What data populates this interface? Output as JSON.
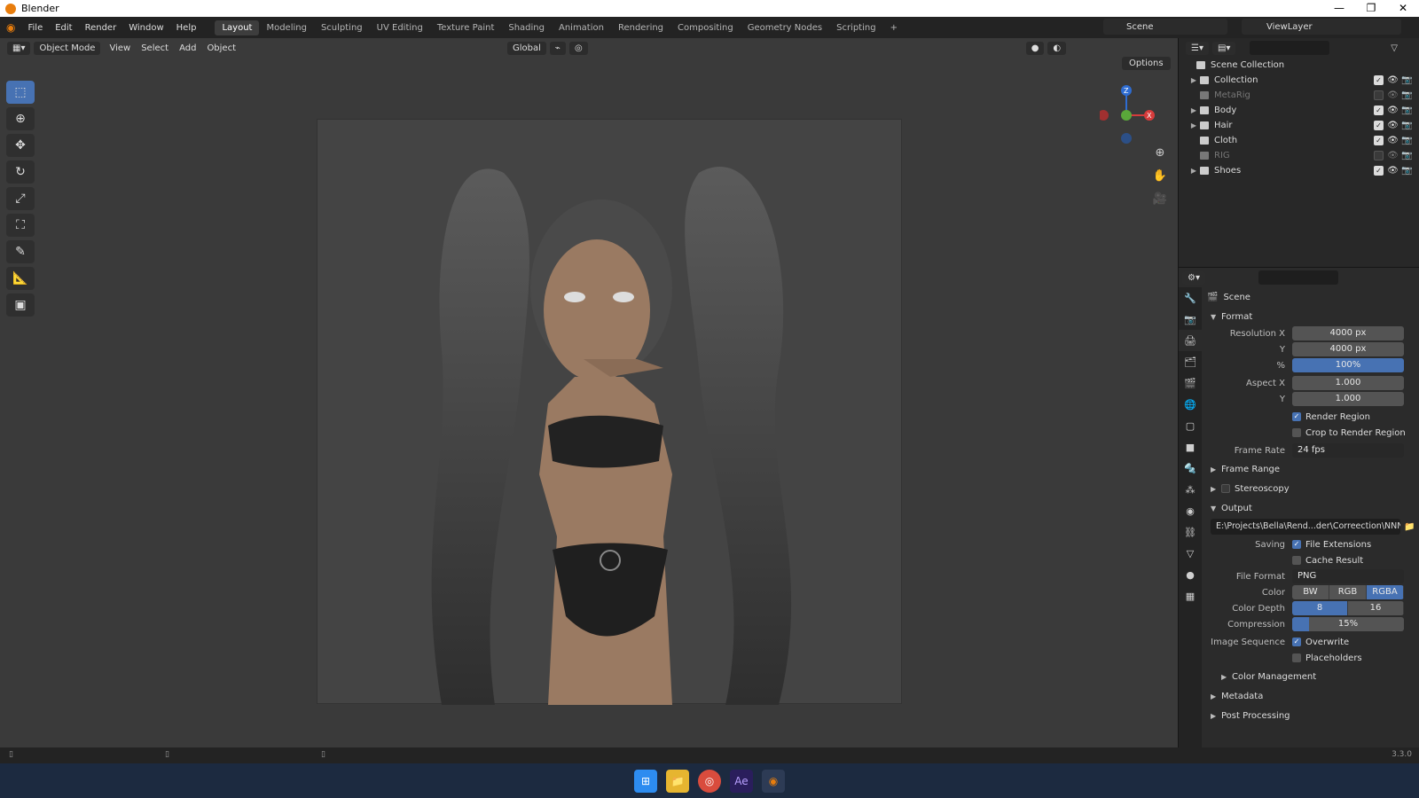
{
  "window": {
    "title": "Blender",
    "controls": [
      "—",
      "❐",
      "✕"
    ]
  },
  "menus": [
    "File",
    "Edit",
    "Render",
    "Window",
    "Help"
  ],
  "workspaces": [
    {
      "label": "Layout",
      "active": true
    },
    {
      "label": "Modeling"
    },
    {
      "label": "Sculpting"
    },
    {
      "label": "UV Editing"
    },
    {
      "label": "Texture Paint"
    },
    {
      "label": "Shading"
    },
    {
      "label": "Animation"
    },
    {
      "label": "Rendering"
    },
    {
      "label": "Compositing"
    },
    {
      "label": "Geometry Nodes"
    },
    {
      "label": "Scripting"
    },
    {
      "label": "+"
    }
  ],
  "scene_name": "Scene",
  "view_layer": "ViewLayer",
  "viewport": {
    "mode": "Object Mode",
    "menus": [
      "View",
      "Select",
      "Add",
      "Object"
    ],
    "transform_orientation": "Global",
    "options_label": "Options"
  },
  "tools": [
    "select-box",
    "cursor",
    "move",
    "rotate",
    "scale",
    "transform",
    "annotate",
    "measure",
    "add-cube"
  ],
  "gizmo": {
    "z": "Z",
    "x": "X"
  },
  "outliner": {
    "root": "Scene Collection",
    "rows": [
      {
        "name": "Collection",
        "expandable": true,
        "visible": true,
        "dim": false
      },
      {
        "name": "MetaRig",
        "expandable": false,
        "visible": false,
        "dim": true
      },
      {
        "name": "Body",
        "expandable": true,
        "visible": true,
        "dim": false
      },
      {
        "name": "Hair",
        "expandable": true,
        "visible": true,
        "dim": false
      },
      {
        "name": "Cloth",
        "expandable": false,
        "visible": true,
        "dim": false
      },
      {
        "name": "RIG",
        "expandable": false,
        "visible": false,
        "dim": true
      },
      {
        "name": "Shoes",
        "expandable": true,
        "visible": true,
        "dim": false
      }
    ]
  },
  "properties": {
    "context": "Scene",
    "format": {
      "header": "Format",
      "resolution_x_label": "Resolution X",
      "resolution_x": "4000 px",
      "y_label": "Y",
      "resolution_y": "4000 px",
      "pct_label": "%",
      "percent": "100%",
      "aspect_x_label": "Aspect X",
      "aspect_x": "1.000",
      "aspect_y": "1.000",
      "render_region": "Render Region",
      "crop": "Crop to Render Region",
      "frame_rate_label": "Frame Rate",
      "frame_rate": "24 fps"
    },
    "frame_range": "Frame Range",
    "stereoscopy": "Stereoscopy",
    "output": {
      "header": "Output",
      "path": "E:\\Projects\\Bella\\Rend...der\\Correection\\NNNN_",
      "saving_label": "Saving",
      "file_extensions": "File Extensions",
      "cache_result": "Cache Result",
      "file_format_label": "File Format",
      "file_format": "PNG",
      "color_label": "Color",
      "color_options": [
        "BW",
        "RGB",
        "RGBA"
      ],
      "color_selected": "RGBA",
      "depth_label": "Color Depth",
      "depth_options": [
        "8",
        "16"
      ],
      "depth_selected": "8",
      "compression_label": "Compression",
      "compression": "15%",
      "compression_value": 15,
      "image_sequence_label": "Image Sequence",
      "overwrite": "Overwrite",
      "placeholders": "Placeholders",
      "color_management": "Color Management"
    },
    "metadata": "Metadata",
    "post_processing": "Post Processing"
  },
  "version": "3.3.0",
  "colors": {
    "accent": "#4772b3",
    "bg": "#3a3a3a",
    "panel": "#2b2b2b"
  }
}
